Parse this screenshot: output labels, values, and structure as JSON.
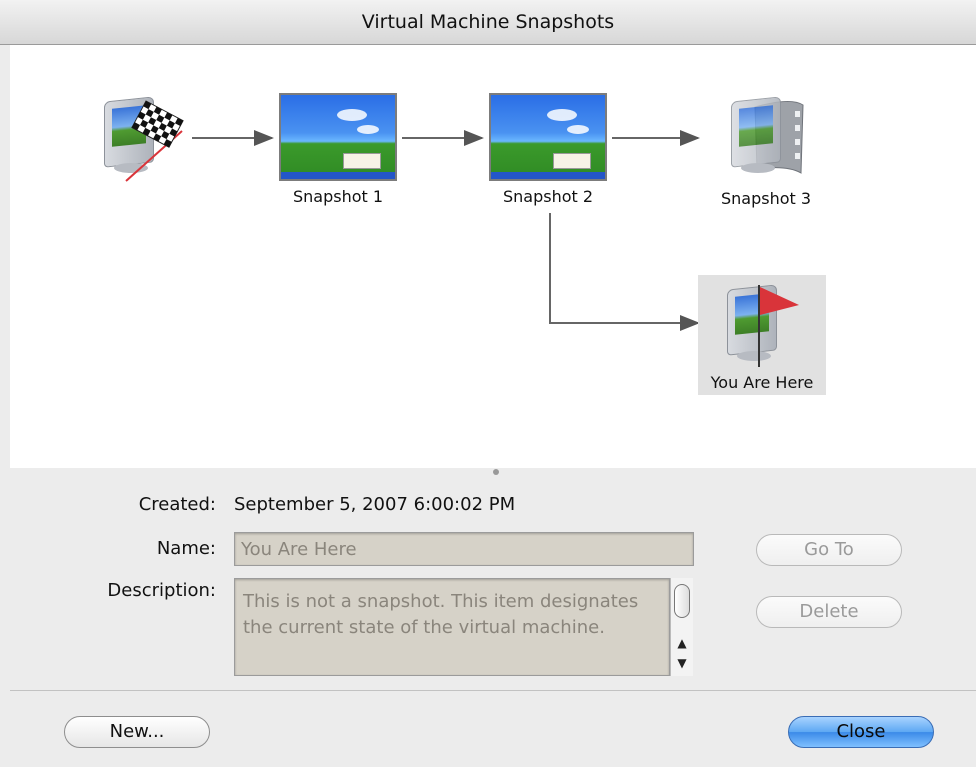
{
  "window": {
    "title": "Virtual Machine Snapshots"
  },
  "tree": {
    "nodes": [
      {
        "id": "start",
        "label": "",
        "icon": "checkered-flag-vm-icon"
      },
      {
        "id": "snap1",
        "label": "Snapshot 1",
        "icon": "xp-desktop-thumbnail"
      },
      {
        "id": "snap2",
        "label": "Snapshot 2",
        "icon": "xp-desktop-thumbnail"
      },
      {
        "id": "snap3",
        "label": "Snapshot 3",
        "icon": "vm-film-icon"
      },
      {
        "id": "current",
        "label": "You Are Here",
        "icon": "red-flag-vm-icon"
      }
    ]
  },
  "details": {
    "created_label": "Created:",
    "created_value": "September 5, 2007 6:00:02 PM",
    "name_label": "Name:",
    "name_value": "You Are Here",
    "description_label": "Description:",
    "description_value": "This is not a snapshot. This item designates the current state of the virtual machine."
  },
  "buttons": {
    "goto": "Go To",
    "delete": "Delete",
    "new": "New...",
    "close": "Close"
  },
  "colors": {
    "primary_button": "#5ea8f3",
    "field_background": "#d6d2c8",
    "flag_red": "#d9343a"
  }
}
